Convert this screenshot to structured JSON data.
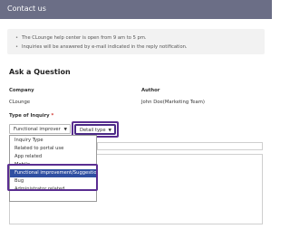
{
  "window": {
    "title": "Contact us"
  },
  "notice": {
    "lines": [
      "The CLounge help center is open from 9 am to 5 pm.",
      "Inquiries will be answered by e-mail indicated in the reply notification."
    ]
  },
  "form": {
    "section_title": "Ask a Question",
    "company_label": "Company",
    "company_value": "CLounge",
    "author_label": "Author",
    "author_value": "John Doe(Marketing Team)",
    "type_label": "Type of Inquiry",
    "required_mark": "*",
    "type_select_value": "Functional improver",
    "detail_select_value": "Detail type",
    "arrow_glyph": "▼"
  },
  "dropdown": {
    "options": [
      "Inquiry Type",
      "Related to portal use",
      "App related",
      "Mobile",
      "Functional improvement/Suggestion",
      "Bug",
      "Administrator related"
    ],
    "selected_index": 4
  },
  "colors": {
    "titlebar": "#6b6e86",
    "highlight_frame": "#5a2d91",
    "selected_option": "#2f4fa1",
    "required": "#d0332b"
  }
}
